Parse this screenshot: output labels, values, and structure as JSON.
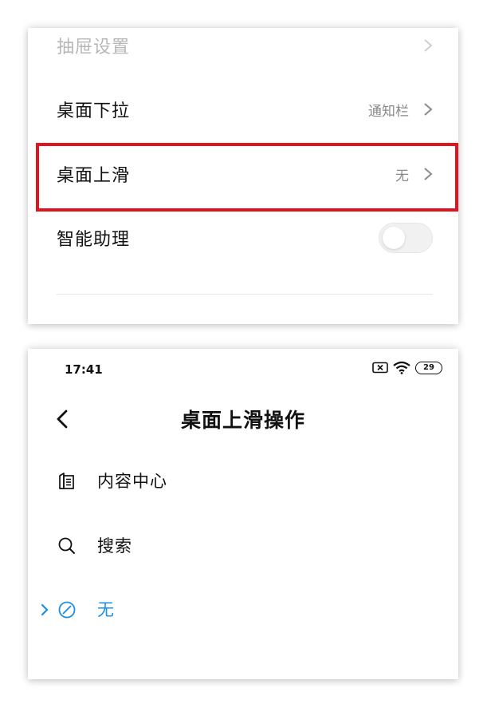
{
  "settings_panel": {
    "items": [
      {
        "label": "抽屉设置",
        "value": ""
      },
      {
        "label": "桌面下拉",
        "value": "通知栏"
      },
      {
        "label": "桌面上滑",
        "value": "无"
      },
      {
        "label": "智能助理",
        "toggle_on": false
      }
    ],
    "highlight_color": "#e0141e"
  },
  "status_bar": {
    "time": "17:41",
    "battery": "29"
  },
  "swipe_up_page": {
    "title": "桌面上滑操作",
    "options": [
      {
        "label": "内容中心",
        "icon": "content-center-icon",
        "selected": false
      },
      {
        "label": "搜索",
        "icon": "search-icon",
        "selected": false
      },
      {
        "label": "无",
        "icon": "none-icon",
        "selected": true
      }
    ],
    "accent_color": "#1e8fe0"
  }
}
